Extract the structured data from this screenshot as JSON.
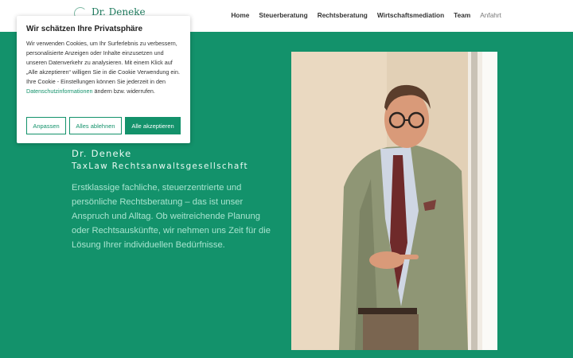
{
  "header": {
    "logo_text": "Dr. Deneke",
    "nav": [
      "Home",
      "Steuerberatung",
      "Rechtsberatung",
      "Wirtschaftsmediation",
      "Team",
      "Anfahrt"
    ]
  },
  "hero": {
    "name": "Dr. Deneke",
    "firm": "TaxLaw Rechtsanwaltsgesellschaft",
    "text": "Erstklassige fachliche, steuerzentrierte und persönliche Rechtsberatung – das ist unser Anspruch und Alltag. Ob weitreichende Planung oder Rechtsauskünfte, wir nehmen uns Zeit für die Lösung Ihrer individuellen Bedürfnisse."
  },
  "cookie": {
    "title": "Wir schätzen Ihre Privatsphäre",
    "body_before": "Wir verwenden Cookies, um Ihr Surferlebnis zu verbessern, personalisierte Anzeigen oder Inhalte einzusetzen und unseren Datenverkehr zu analysieren. Mit einem Klick auf „Alle akzeptieren“ willigen Sie in die Cookie Verwendung ein. Ihre Cookie - Einstellungen können Sie jederzeit in den ",
    "link": "Datenschutzinformationen",
    "body_after": " ändern bzw. widerrufen.",
    "customize": "Anpassen",
    "reject": "Alles ablehnen",
    "accept": "Alle akzeptieren"
  },
  "colors": {
    "brand_green": "#13926b",
    "hero_text": "#a8e4cf"
  }
}
